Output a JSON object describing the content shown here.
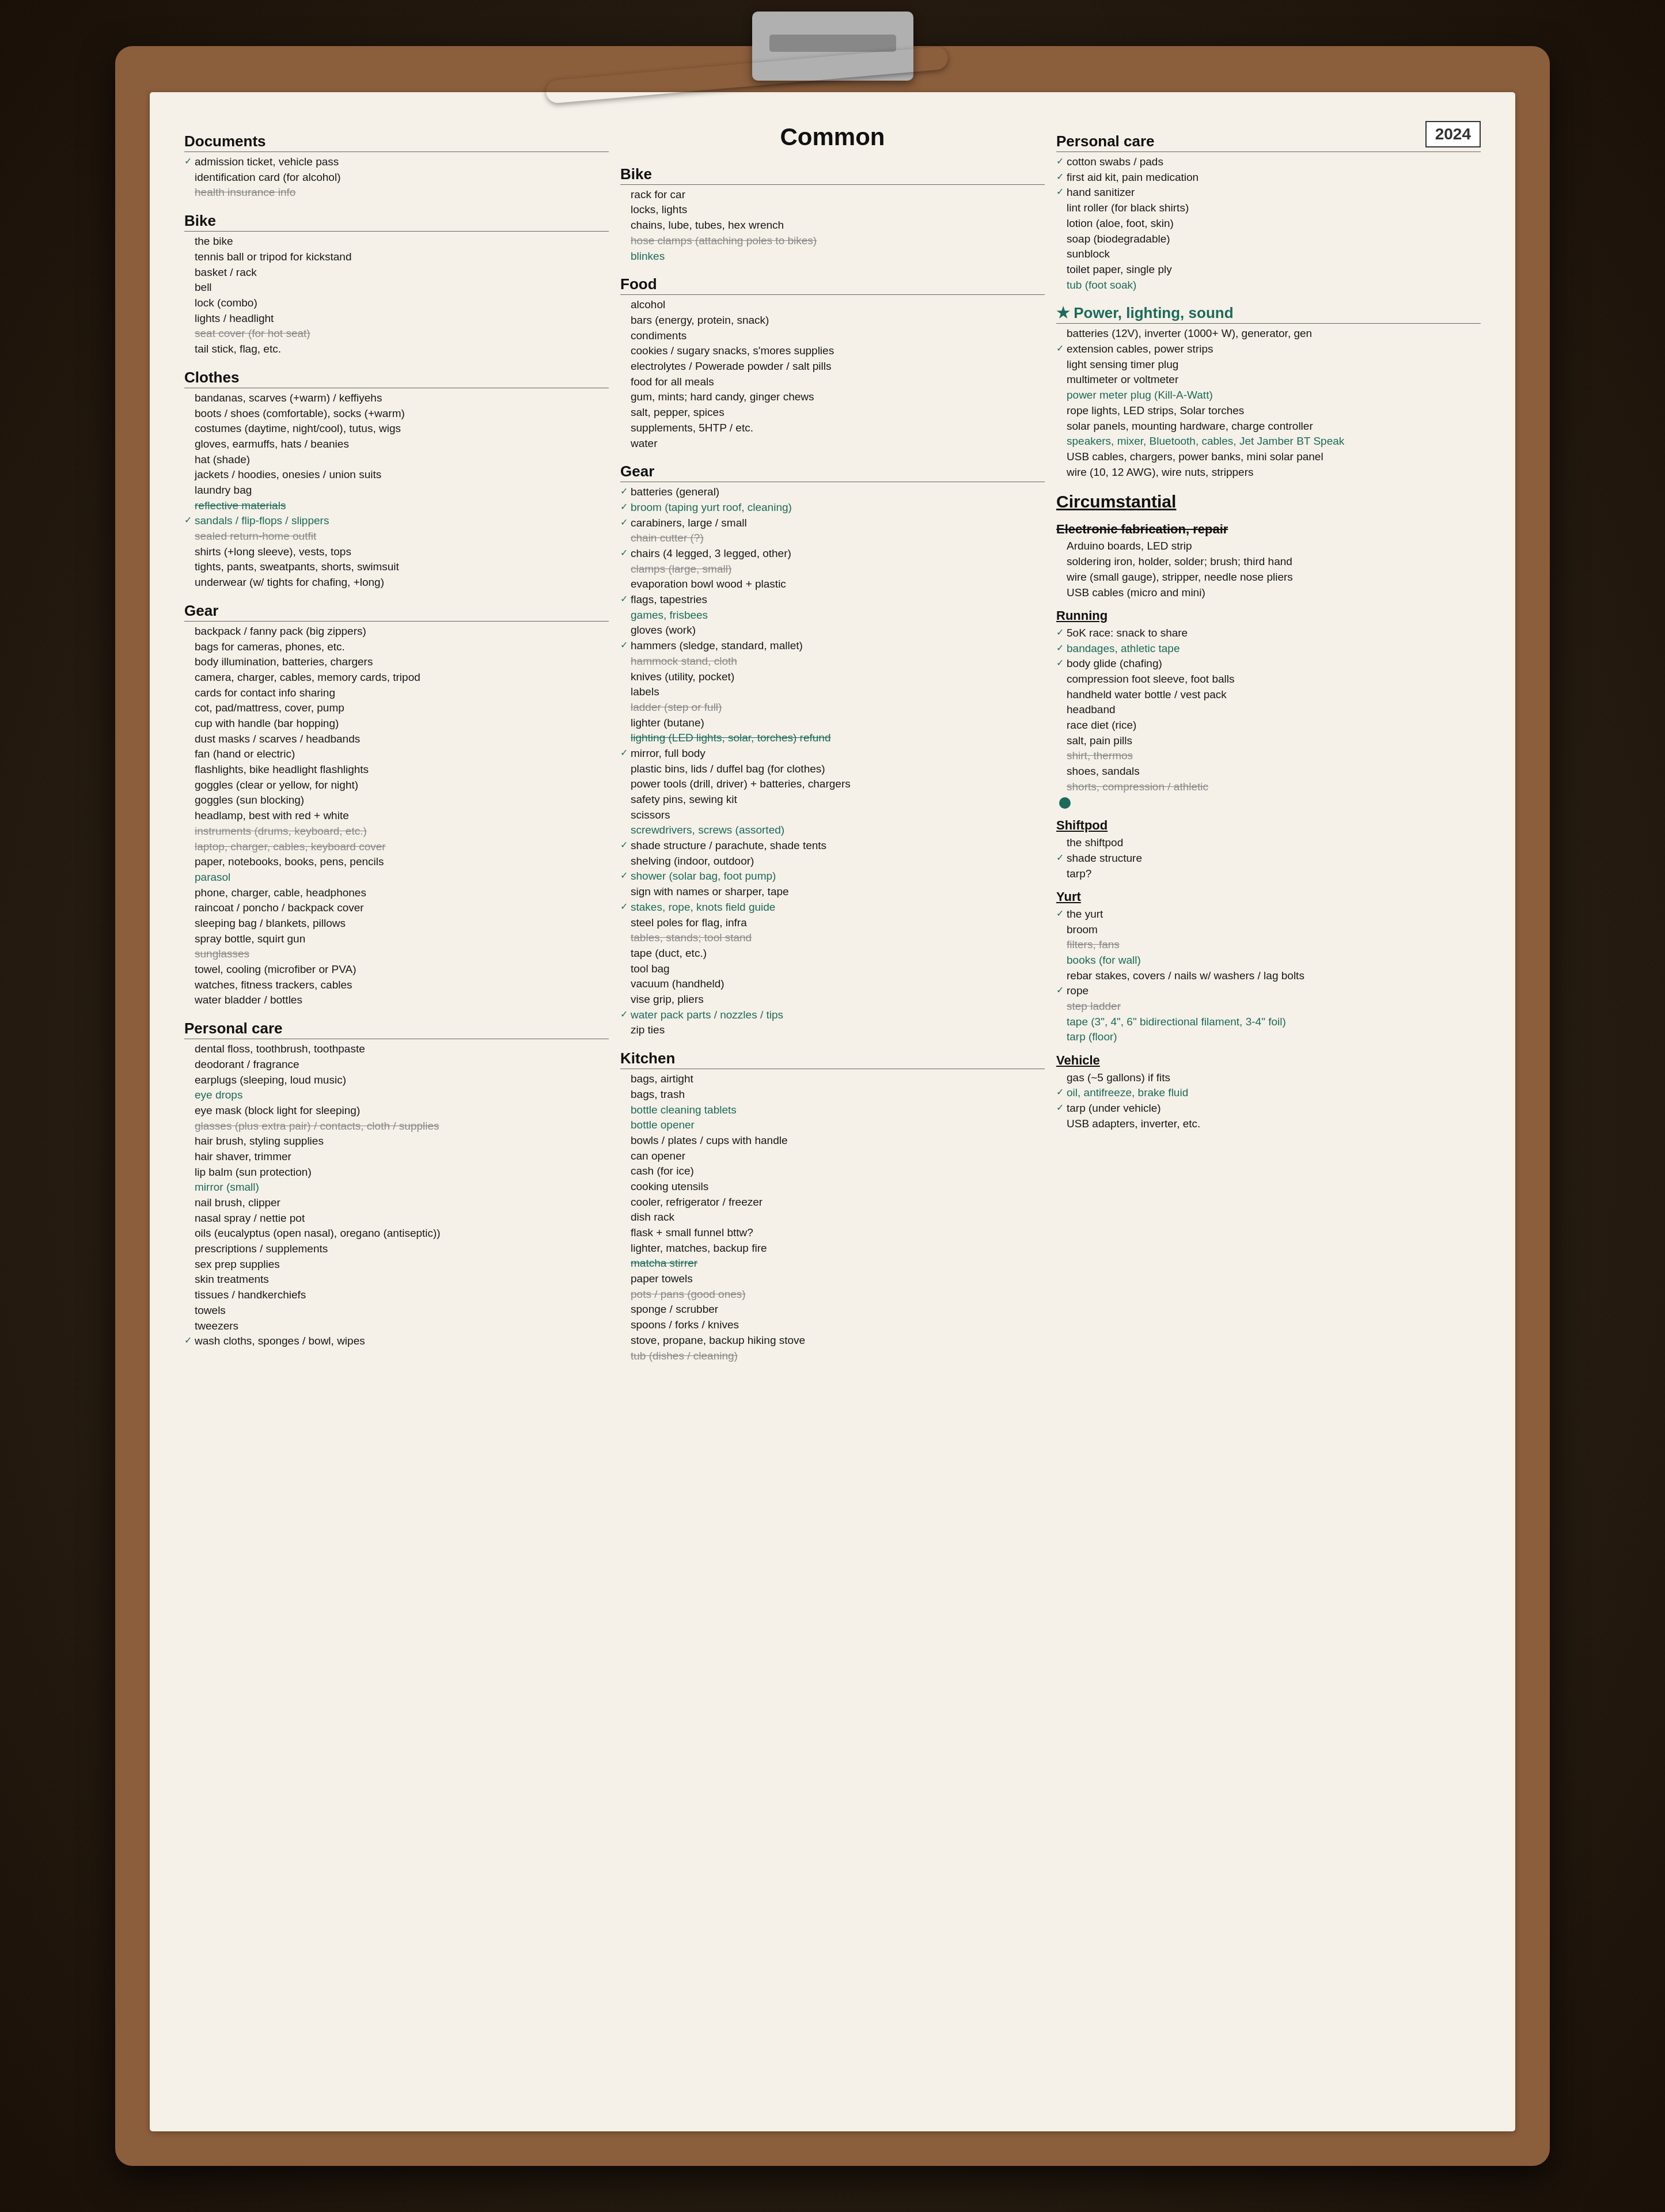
{
  "year": "2024",
  "page_title": "Common",
  "col1": {
    "documents": {
      "title": "Documents",
      "items": [
        {
          "text": "admission ticket, vehicle pass",
          "checked": true
        },
        {
          "text": "identification card (for alcohol)",
          "checked": false
        },
        {
          "text": "health insurance info",
          "strike": true
        }
      ]
    },
    "bike": {
      "title": "Bike",
      "items": [
        {
          "text": "the bike",
          "checked": false
        },
        {
          "text": "tennis ball or tripod for kickstand",
          "checked": false
        },
        {
          "text": "basket / rack",
          "checked": false
        },
        {
          "text": "bell",
          "checked": false
        },
        {
          "text": "lock (combo)",
          "checked": false
        },
        {
          "text": "lights / headlight",
          "checked": false
        },
        {
          "text": "seat cover (for hot seat)",
          "strike": true
        },
        {
          "text": "tail stick, flag, etc.",
          "checked": false
        }
      ]
    },
    "clothes": {
      "title": "Clothes",
      "items": [
        {
          "text": "bandanas, scarves (+warm) / keffiyehs",
          "checked": false
        },
        {
          "text": "boots / shoes (comfortable), socks (+warm)",
          "checked": false
        },
        {
          "text": "costumes (daytime, night/cool), tutus, wigs",
          "checked": false
        },
        {
          "text": "gloves, earmuffs, hats / beanies",
          "checked": false
        },
        {
          "text": "hat (shade)",
          "checked": false
        },
        {
          "text": "jackets / hoodies, onesies / union suits",
          "checked": false
        },
        {
          "text": "laundry bag",
          "checked": false
        },
        {
          "text": "reflective materials",
          "strike": true,
          "teal": true
        },
        {
          "text": "sandals / flip-flops / slippers",
          "checked": true,
          "teal": true
        },
        {
          "text": "sealed return-home outfit",
          "checked": false,
          "strike": true
        },
        {
          "text": "shirts (+long sleeve), vests, tops",
          "checked": false
        },
        {
          "text": "tights, pants, sweatpants, shorts, swimsuit",
          "checked": false
        },
        {
          "text": "underwear (w/ tights for chafing, +long)",
          "checked": false
        }
      ]
    },
    "gear": {
      "title": "Gear",
      "items": [
        {
          "text": "backpack / fanny pack (big zippers)",
          "checked": false
        },
        {
          "text": "bags for cameras, phones, etc.",
          "checked": false
        },
        {
          "text": "body illumination, batteries, chargers",
          "checked": false
        },
        {
          "text": "camera, charger, cables, memory cards, tripod",
          "checked": false
        },
        {
          "text": "cards for contact info sharing",
          "checked": false
        },
        {
          "text": "cot, pad/mattress, cover, pump",
          "checked": false
        },
        {
          "text": "cup with handle (bar hopping)",
          "checked": false
        },
        {
          "text": "dust masks / scarves / headbands",
          "checked": false
        },
        {
          "text": "fan (hand or electric)",
          "checked": false
        },
        {
          "text": "flashlights, bike headlight flashlights",
          "checked": false
        },
        {
          "text": "goggles (clear or yellow, for night)",
          "checked": false
        },
        {
          "text": "goggles (sun blocking)",
          "checked": false
        },
        {
          "text": "headlamp, best with red + white",
          "checked": false
        },
        {
          "text": "instruments (drums, keyboard, etc.)",
          "strike": true
        },
        {
          "text": "laptop, charger, cables, keyboard cover",
          "checked": false,
          "strike": true
        },
        {
          "text": "paper, notebooks, books, pens, pencils",
          "checked": false
        },
        {
          "text": "parasol",
          "checked": false,
          "teal": true
        },
        {
          "text": "phone, charger, cable, headphones",
          "checked": false
        },
        {
          "text": "raincoat / poncho / backpack cover",
          "checked": false
        },
        {
          "text": "sleeping bag / blankets, pillows",
          "checked": false
        },
        {
          "text": "spray bottle, squirt gun",
          "checked": false
        },
        {
          "text": "sunglasses",
          "checked": false,
          "strike": true
        },
        {
          "text": "towel, cooling (microfiber or PVA)",
          "checked": false
        },
        {
          "text": "watches, fitness trackers, cables",
          "checked": false
        },
        {
          "text": "water bladder / bottles",
          "checked": false
        }
      ]
    },
    "personal_care": {
      "title": "Personal care",
      "items": [
        {
          "text": "dental floss, toothbrush, toothpaste",
          "checked": false
        },
        {
          "text": "deodorant / fragrance",
          "checked": false
        },
        {
          "text": "earplugs (sleeping, loud music)",
          "checked": false
        },
        {
          "text": "eye drops",
          "checked": false,
          "teal": true
        },
        {
          "text": "eye mask (block light for sleeping)",
          "checked": false
        },
        {
          "text": "glasses (plus extra pair) / contacts, cloth / supplies",
          "strike": true
        },
        {
          "text": "hair brush, styling supplies",
          "checked": false
        },
        {
          "text": "hair shaver, trimmer",
          "checked": false
        },
        {
          "text": "lip balm (sun protection)",
          "checked": false
        },
        {
          "text": "mirror (small)",
          "checked": false,
          "teal": true
        },
        {
          "text": "nail brush, clipper",
          "checked": false
        },
        {
          "text": "nasal spray / nettie pot",
          "checked": false
        },
        {
          "text": "oils (eucalyptus (open nasal), oregano (antiseptic))",
          "checked": false
        },
        {
          "text": "prescriptions / supplements",
          "checked": false
        },
        {
          "text": "sex prep supplies",
          "checked": false
        },
        {
          "text": "skin treatments",
          "checked": false
        },
        {
          "text": "tissues / handkerchiefs",
          "checked": false
        },
        {
          "text": "towels",
          "checked": false
        },
        {
          "text": "tweezers",
          "checked": false
        },
        {
          "text": "wash cloths, sponges / bowl, wipes",
          "checked": true
        }
      ]
    }
  },
  "col2": {
    "common_title": "Common",
    "bike": {
      "title": "Bike",
      "items": [
        {
          "text": "rack for car"
        },
        {
          "text": "locks, lights"
        },
        {
          "text": "chains, lube, tubes, hex wrench"
        },
        {
          "text": "hose clamps (attaching poles to bikes)",
          "strike": true
        },
        {
          "text": "blinkes",
          "teal": true
        }
      ]
    },
    "food": {
      "title": "Food",
      "items": [
        {
          "text": "alcohol"
        },
        {
          "text": "bars (energy, protein, snack)"
        },
        {
          "text": "condiments"
        },
        {
          "text": "cookies / sugary snacks, s'mores supplies"
        },
        {
          "text": "electrolytes / Powerade powder / salt pills"
        },
        {
          "text": "food for all meals"
        },
        {
          "text": "gum, mints; hard candy, ginger chews"
        },
        {
          "text": "salt, pepper, spices"
        },
        {
          "text": "supplements, 5HTP / etc."
        },
        {
          "text": "water"
        }
      ]
    },
    "gear": {
      "title": "Gear",
      "items": [
        {
          "text": "batteries (general)",
          "checked": true
        },
        {
          "text": "broom (taping yurt roof, cleaning)",
          "checked": true,
          "teal": true
        },
        {
          "text": "carabiners, large / small",
          "checked": true
        },
        {
          "text": "chain cutter (?)",
          "strike": true
        },
        {
          "text": "chairs (4 legged, 3 legged, other)",
          "checked": true
        },
        {
          "text": "clamps (large, small)",
          "checked": false,
          "strike": true
        },
        {
          "text": "evaporation bowl wood + plastic",
          "checked": false
        },
        {
          "text": "flags, tapestries",
          "checked": true
        },
        {
          "text": "games, frisbees",
          "checked": false,
          "teal": true
        },
        {
          "text": "gloves (work)",
          "checked": false
        },
        {
          "text": "hammers (sledge, standard, mallet)",
          "checked": true
        },
        {
          "text": "hammock stand, cloth",
          "checked": false,
          "strike": true
        },
        {
          "text": "knives (utility, pocket)",
          "checked": false
        },
        {
          "text": "labels",
          "checked": false
        },
        {
          "text": "ladder (step or full)",
          "checked": false,
          "strike": true
        },
        {
          "text": "lighter (butane)",
          "checked": false
        },
        {
          "text": "lighting (LED lights, solar, torches) refund",
          "strike": true,
          "teal": true
        },
        {
          "text": "mirror, full body",
          "checked": true
        },
        {
          "text": "plastic bins, lids / duffel bag (for clothes)",
          "checked": false
        },
        {
          "text": "power tools (drill, driver) + batteries, chargers",
          "checked": false
        },
        {
          "text": "safety pins, sewing kit",
          "checked": false
        },
        {
          "text": "scissors",
          "checked": false
        },
        {
          "text": "screwdrivers, screws (assorted)",
          "checked": false,
          "teal": true
        },
        {
          "text": "shade structure / parachute, shade tents",
          "checked": true
        },
        {
          "text": "shelving (indoor, outdoor)",
          "checked": false
        },
        {
          "text": "shower (solar bag, foot pump)",
          "checked": true,
          "teal": true
        },
        {
          "text": "sign with names or sharper, tape",
          "checked": false
        },
        {
          "text": "stakes, rope, knots field guide",
          "checked": true,
          "teal": true
        },
        {
          "text": "steel poles for flag, infra",
          "checked": false
        },
        {
          "text": "tables, stands; tool stand",
          "strike": true
        },
        {
          "text": "tape (duct, etc.)",
          "checked": false
        },
        {
          "text": "tool bag",
          "checked": false
        },
        {
          "text": "vacuum (handheld)",
          "checked": false
        },
        {
          "text": "vise grip, pliers",
          "checked": false
        },
        {
          "text": "water pack parts / nozzles / tips",
          "checked": true,
          "teal": true
        },
        {
          "text": "zip ties",
          "checked": false
        }
      ]
    },
    "kitchen": {
      "title": "Kitchen",
      "items": [
        {
          "text": "bags, airtight",
          "checked": false
        },
        {
          "text": "bags, trash",
          "checked": false
        },
        {
          "text": "bottle cleaning tablets",
          "checked": false,
          "teal": true
        },
        {
          "text": "bottle opener",
          "checked": false,
          "teal": true
        },
        {
          "text": "bowls / plates / cups with handle",
          "checked": false
        },
        {
          "text": "can opener",
          "checked": false
        },
        {
          "text": "cash (for ice)",
          "checked": false
        },
        {
          "text": "cooking utensils",
          "checked": false
        },
        {
          "text": "cooler, refrigerator / freezer",
          "checked": false
        },
        {
          "text": "dish rack",
          "checked": false
        },
        {
          "text": "flask + small funnel  bttw?",
          "checked": false
        },
        {
          "text": "lighter, matches, backup fire",
          "checked": false
        },
        {
          "text": "matcha stirrer",
          "strike": true,
          "teal": true
        },
        {
          "text": "paper towels",
          "checked": false
        },
        {
          "text": "pots / pans (good ones)",
          "strike": true
        },
        {
          "text": "sponge / scrubber",
          "checked": false
        },
        {
          "text": "spoons / forks / knives",
          "checked": false
        },
        {
          "text": "stove, propane, backup hiking stove",
          "checked": false
        },
        {
          "text": "tub (dishes / cleaning)",
          "strike": true
        }
      ]
    }
  },
  "col3": {
    "personal_care": {
      "title": "Personal care",
      "items": [
        {
          "text": "cotton swabs / pads",
          "checked": true
        },
        {
          "text": "first aid kit, pain medication",
          "checked": true
        },
        {
          "text": "hand sanitizer",
          "checked": true
        },
        {
          "text": "lint roller (for black shirts)",
          "checked": false
        },
        {
          "text": "lotion (aloe, foot, skin)",
          "checked": false
        },
        {
          "text": "soap (biodegradable)",
          "checked": false
        },
        {
          "text": "sunblock",
          "checked": false,
          "strike_partial": true
        },
        {
          "text": "toilet paper, single ply",
          "checked": false
        },
        {
          "text": "tub (foot soak)",
          "checked": false,
          "teal": true
        }
      ]
    },
    "power": {
      "title": "★ Power, lighting, sound",
      "teal_title": true,
      "items": [
        {
          "text": "batteries (12V), inverter (1000+ W), generator, gen",
          "checked": false
        },
        {
          "text": "extension cables, power strips",
          "checked": true
        },
        {
          "text": "light sensing timer plug",
          "checked": false
        },
        {
          "text": "multimeter or voltmeter",
          "checked": false
        },
        {
          "text": "power meter plug (Kill-A-Watt)",
          "checked": false,
          "teal": true
        },
        {
          "text": "rope lights, LED strips, Solar torches",
          "checked": false
        },
        {
          "text": "solar panels, mounting hardware, charge controller",
          "checked": false
        },
        {
          "text": "speakers, mixer, Bluetooth, cables, Jet Jamber BT Speak",
          "checked": false,
          "teal": true
        },
        {
          "text": "USB cables, chargers, power banks, mini solar panel",
          "checked": false
        },
        {
          "text": "wire (10, 12 AWG), wire nuts, strippers",
          "checked": false
        }
      ]
    },
    "circumstantial": {
      "title": "Circumstantial",
      "subtitle_efab": "Electronic fabrication, repair",
      "efab_items": [
        {
          "text": "Arduino boards, LED strip",
          "checked": false
        },
        {
          "text": "soldering iron, holder, solder; brush; third hand",
          "checked": false
        },
        {
          "text": "wire (small gauge), stripper, needle nose pliers",
          "checked": false
        },
        {
          "text": "USB cables (micro and mini)",
          "checked": false
        }
      ],
      "subtitle_running": "Running",
      "running_items": [
        {
          "text": "5oK race: snack to share",
          "checked": true
        },
        {
          "text": "bandages, athletic tape",
          "checked": true,
          "teal": true
        },
        {
          "text": "body glide (chafing)",
          "checked": true
        },
        {
          "text": "compression foot sleeve, foot balls",
          "checked": false
        },
        {
          "text": "handheld water bottle / vest pack",
          "checked": false
        },
        {
          "text": "headband",
          "checked": false
        },
        {
          "text": "race diet (rice)",
          "checked": false
        },
        {
          "text": "salt, pain pills",
          "checked": false
        },
        {
          "text": "shirt, thermos",
          "checked": false,
          "strike": true
        },
        {
          "text": "shoes, sandals",
          "checked": false
        },
        {
          "text": "shorts, compression / athletic",
          "strike": true
        }
      ],
      "subtitle_shiftpod": "Shiftpod",
      "shiftpod_items": [
        {
          "text": "the shiftpod",
          "checked": false
        },
        {
          "text": "shade structure",
          "checked": true
        },
        {
          "text": "tarp?",
          "checked": false
        }
      ],
      "subtitle_yurt": "Yurt",
      "yurt_items": [
        {
          "text": "the yurt",
          "checked": true
        },
        {
          "text": "broom",
          "checked": false
        },
        {
          "text": "filters, fans",
          "strike": true
        },
        {
          "text": "books (for wall)",
          "checked": false,
          "teal": true
        },
        {
          "text": "rebar stakes, covers / nails w/ washers / lag bolts",
          "checked": false
        },
        {
          "text": "rope",
          "checked": true
        },
        {
          "text": "step ladder",
          "checked": false,
          "strike": true
        },
        {
          "text": "tape (3\", 4\", 6\" bidirectional filament, 3-4\" foil)",
          "checked": false,
          "teal": true
        },
        {
          "text": "tarp (floor)",
          "checked": false,
          "teal": true
        }
      ],
      "subtitle_vehicle": "Vehicle",
      "vehicle_items": [
        {
          "text": "gas (~5 gallons)  if fits",
          "checked": false
        },
        {
          "text": "oil, antifreeze, brake fluid",
          "checked": true,
          "teal": true
        },
        {
          "text": "tarp (under vehicle)",
          "checked": true
        },
        {
          "text": "USB adapters, inverter, etc.",
          "checked": false
        }
      ]
    }
  }
}
